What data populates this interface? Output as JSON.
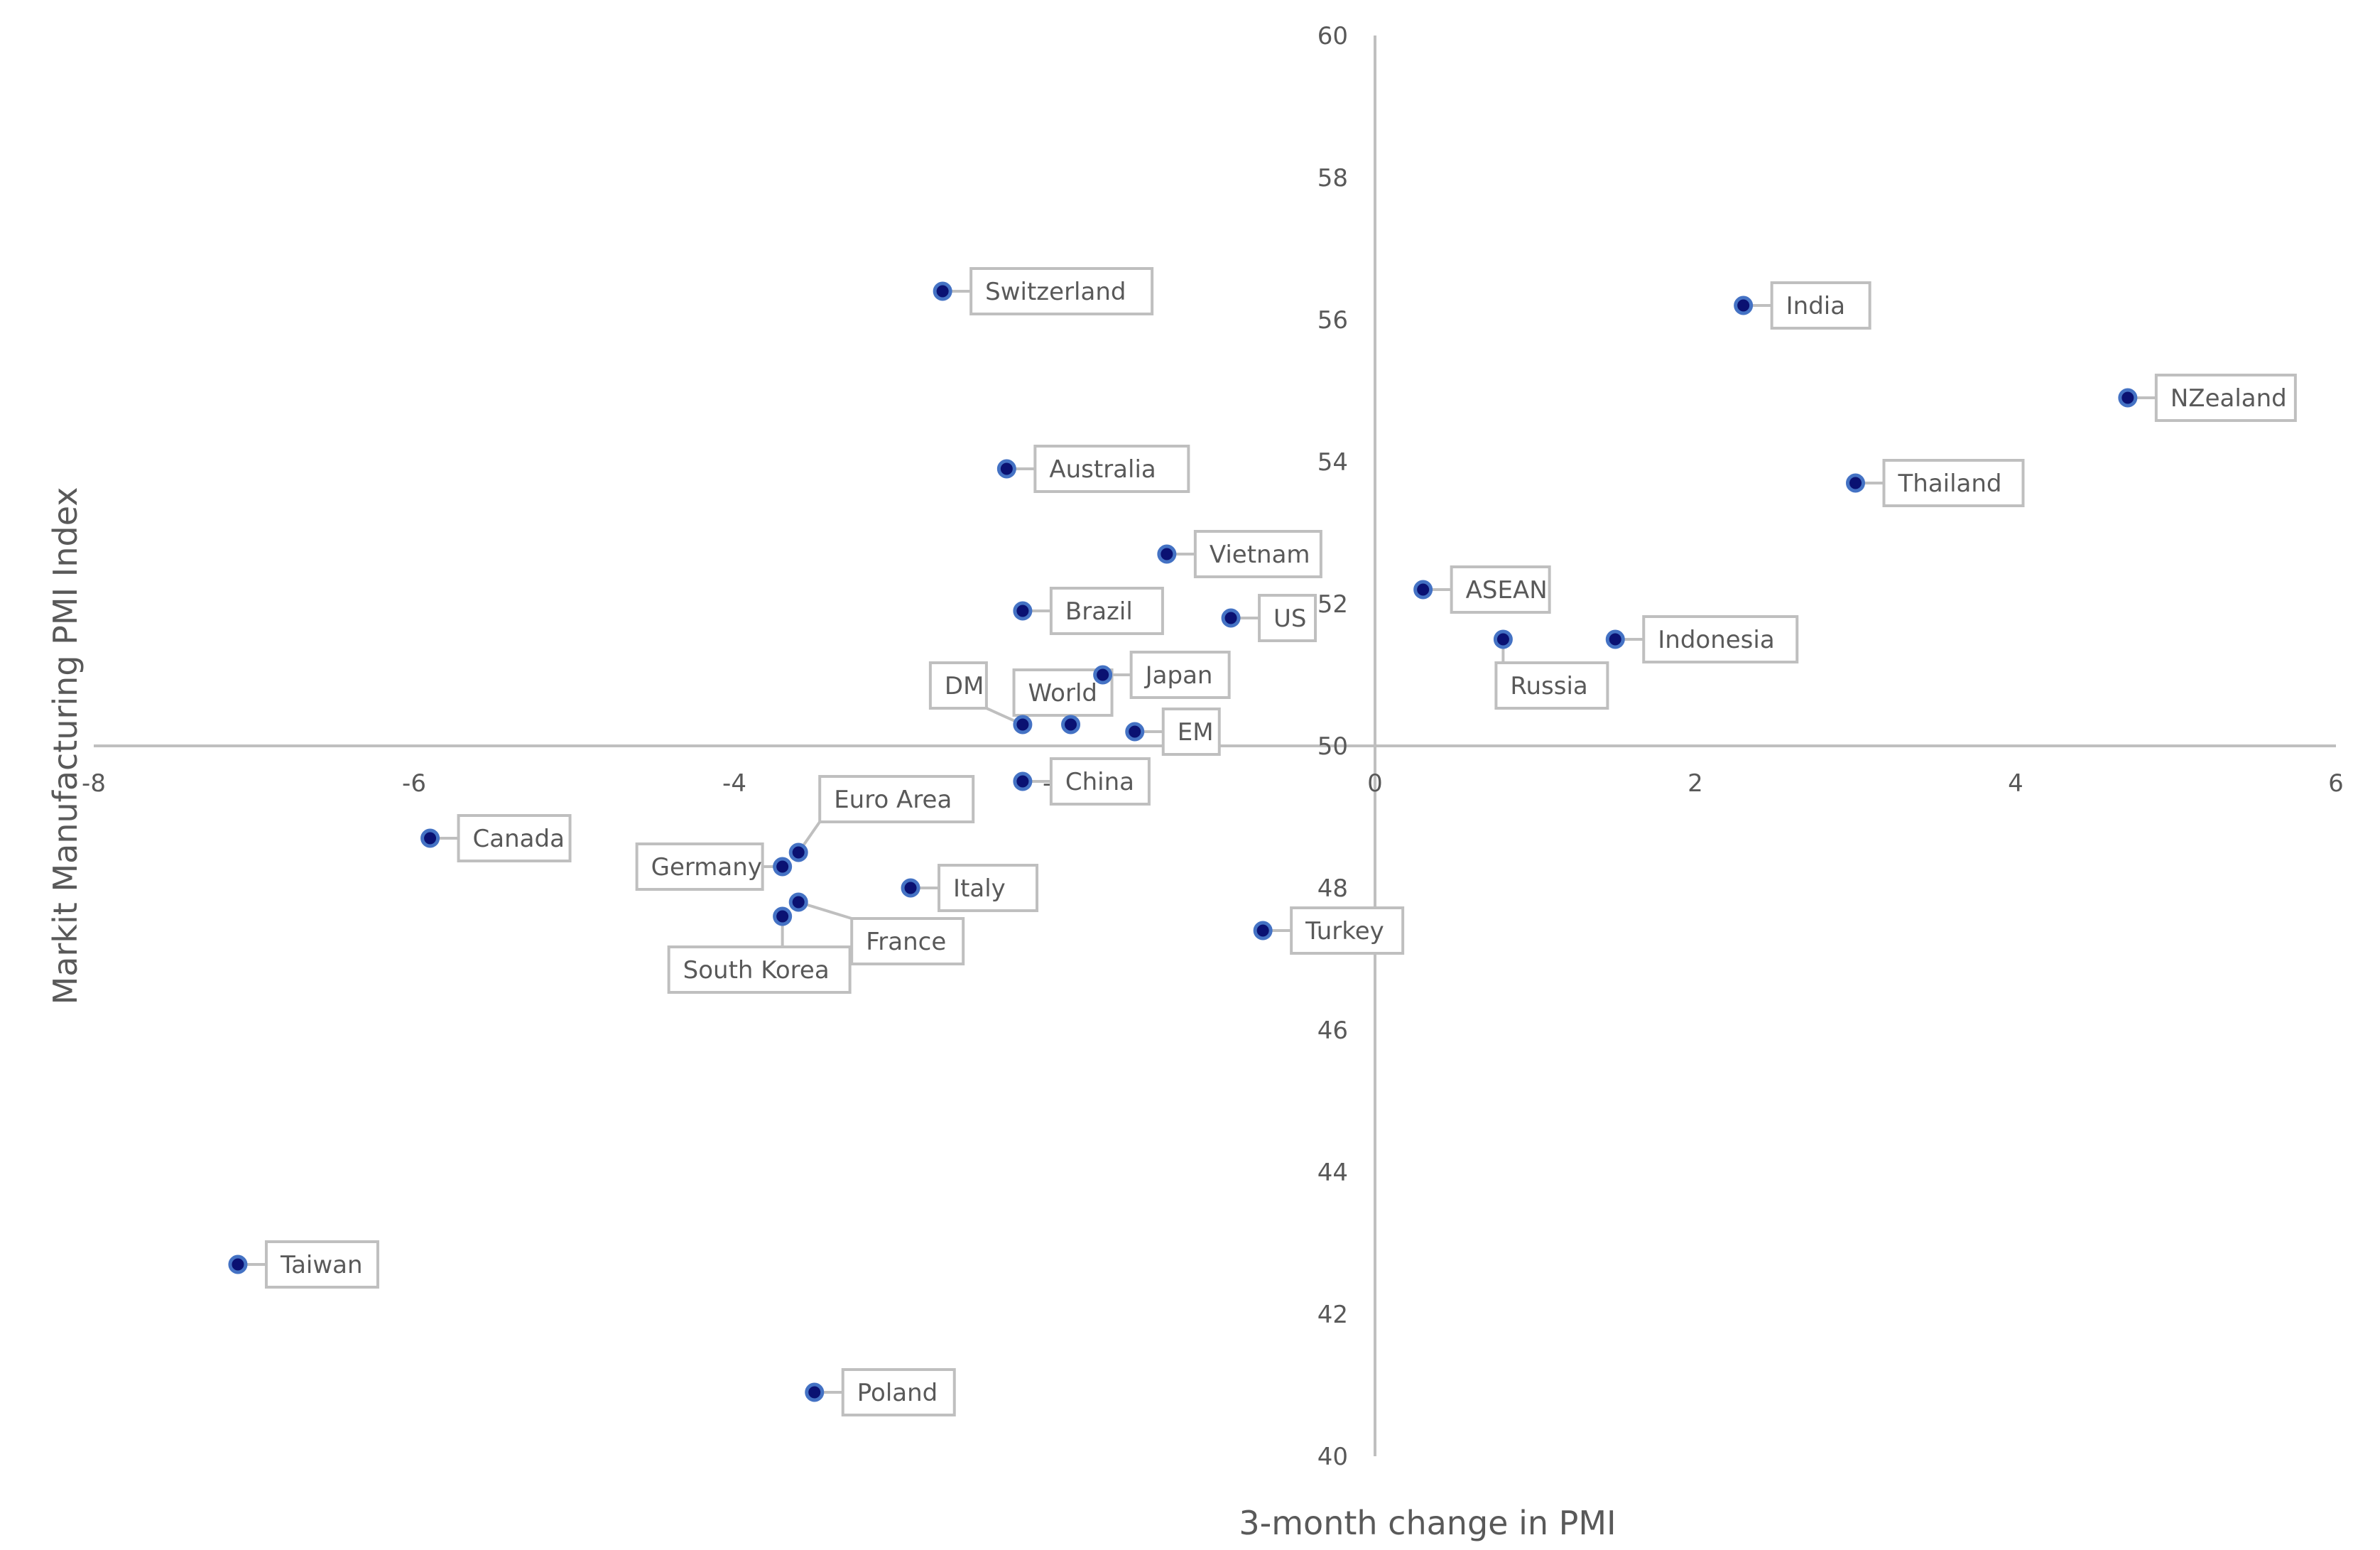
{
  "chart_data": {
    "type": "scatter",
    "title": "",
    "xlabel": "3-month change in PMI",
    "ylabel": "Markit Manufacturing PMI Index",
    "xlim": [
      -8,
      6
    ],
    "ylim": [
      40,
      60
    ],
    "x_ticks": [
      -8,
      -6,
      -4,
      -2,
      0,
      2,
      4,
      6
    ],
    "y_ticks": [
      40,
      42,
      44,
      46,
      48,
      50,
      52,
      54,
      56,
      58,
      60
    ],
    "x_axis_crosses_y_at": 50,
    "y_axis_crosses_x_at": 0,
    "grid": false,
    "legend": "none",
    "marker_color": "#0a1172",
    "marker_edge_color": "#4472c4",
    "axis_color": "#bfbfbf",
    "text_color": "#595959",
    "points": [
      {
        "label": "Switzerland",
        "x": -2.7,
        "y": 56.4
      },
      {
        "label": "India",
        "x": 2.3,
        "y": 56.2
      },
      {
        "label": "NZealand",
        "x": 4.7,
        "y": 54.9
      },
      {
        "label": "Australia",
        "x": -2.3,
        "y": 53.9
      },
      {
        "label": "Thailand",
        "x": 3.0,
        "y": 53.7
      },
      {
        "label": "Vietnam",
        "x": -1.3,
        "y": 52.7
      },
      {
        "label": "ASEAN",
        "x": 0.3,
        "y": 52.2
      },
      {
        "label": "Brazil",
        "x": -2.2,
        "y": 51.9
      },
      {
        "label": "US",
        "x": -0.9,
        "y": 51.8
      },
      {
        "label": "Russia",
        "x": 0.8,
        "y": 51.5
      },
      {
        "label": "Indonesia",
        "x": 1.5,
        "y": 51.5
      },
      {
        "label": "Japan",
        "x": -1.7,
        "y": 51.0
      },
      {
        "label": "DM",
        "x": -2.2,
        "y": 50.3
      },
      {
        "label": "World",
        "x": -1.9,
        "y": 50.3
      },
      {
        "label": "EM",
        "x": -1.5,
        "y": 50.2
      },
      {
        "label": "China",
        "x": -2.2,
        "y": 49.5
      },
      {
        "label": "Canada",
        "x": -5.9,
        "y": 48.7
      },
      {
        "label": "Euro Area",
        "x": -3.6,
        "y": 48.5
      },
      {
        "label": "Germany",
        "x": -3.7,
        "y": 48.3
      },
      {
        "label": "Italy",
        "x": -2.9,
        "y": 48.0
      },
      {
        "label": "France",
        "x": -3.6,
        "y": 47.8
      },
      {
        "label": "South Korea",
        "x": -3.7,
        "y": 47.6
      },
      {
        "label": "Turkey",
        "x": -0.7,
        "y": 47.4
      },
      {
        "label": "Taiwan",
        "x": -7.1,
        "y": 42.7
      },
      {
        "label": "Poland",
        "x": -3.5,
        "y": 40.9
      }
    ]
  }
}
